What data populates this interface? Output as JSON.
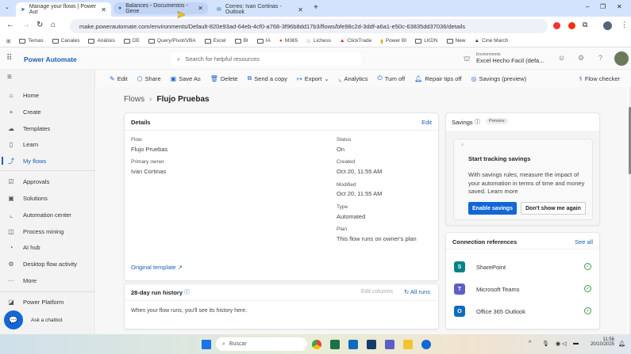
{
  "browser": {
    "tabs": [
      {
        "label": "Manage your flows | Power Aut",
        "active": true
      },
      {
        "label": "Balances - Documentos - Gene",
        "active": false
      },
      {
        "label": "Correo: Ivan Cortinas - Outlook",
        "active": false
      }
    ],
    "new_tab": "+",
    "url": "make.powerautomate.com/environments/Default-820e93ad-64eb-4cf0-a768-3f96b8dd17b3/flows/bfe98c2d-3ddf-a6a1-e50c-63835dd37036/details",
    "bookmarks": [
      "Temas",
      "Canales",
      "Análisis",
      "DE",
      "Query/Pivot/VBA",
      "Excel",
      "BI",
      "IA",
      "M365",
      "Lichess",
      "ClickTrade",
      "Power BI",
      "LKDN",
      "New",
      "Cine March"
    ]
  },
  "app": {
    "name": "Power Automate",
    "search_placeholder": "Search for helpful resources",
    "env_label": "Environments",
    "env_name": "Excel Hecho Facil (defa..."
  },
  "commands": [
    "Edit",
    "Share",
    "Save As",
    "Delete",
    "Send a copy",
    "Export",
    "Analytics",
    "Turn off",
    "Repair tips off",
    "Savings (preview)"
  ],
  "flow_checker": "Flow checker",
  "sidebar": {
    "items": [
      {
        "label": "Home",
        "icon": "⌂"
      },
      {
        "label": "Create",
        "icon": "+"
      },
      {
        "label": "Templates",
        "icon": "☁"
      },
      {
        "label": "Learn",
        "icon": "▯"
      },
      {
        "label": "My flows",
        "icon": "⤴"
      },
      {
        "label": "Approvals",
        "icon": "☑"
      },
      {
        "label": "Solutions",
        "icon": "▣"
      },
      {
        "label": "Automation center",
        "icon": "⌞"
      },
      {
        "label": "Process mining",
        "icon": "◫"
      },
      {
        "label": "AI hub",
        "icon": "◔"
      },
      {
        "label": "Desktop flow activity",
        "icon": "⚙"
      },
      {
        "label": "More",
        "icon": "···"
      },
      {
        "label": "Power Platform",
        "icon": "◪"
      }
    ],
    "chatbot": "Ask a chatbot"
  },
  "breadcrumb": {
    "root": "Flows",
    "current": "Flujo Pruebas"
  },
  "details": {
    "title": "Details",
    "edit": "Edit",
    "flow_label": "Flow",
    "flow": "Flujo Pruebas",
    "owner_label": "Primary owner",
    "owner": "Ivan Cortinas",
    "status_label": "Status",
    "status": "On",
    "created_label": "Created",
    "created": "Oct 20, 11:55 AM",
    "modified_label": "Modified",
    "modified": "Oct 20, 11:55 AM",
    "type_label": "Type",
    "type": "Automated",
    "plan_label": "Plan",
    "plan": "This flow runs on owner's plan",
    "template_link": "Original template"
  },
  "run_history": {
    "title": "28-day run history",
    "edit_columns": "Edit columns",
    "all_runs": "All runs",
    "empty": "When your flow runs, you'll see its history here."
  },
  "savings": {
    "title": "Savings",
    "badge": "Preview",
    "heading": "Start tracking savings",
    "body": "With savings rules, measure the impact of your automation in terms of time and money saved.",
    "learn_more": "Learn more",
    "enable": "Enable savings",
    "dismiss": "Don't show me again"
  },
  "connections": {
    "title": "Connection references",
    "see_all": "See all",
    "items": [
      {
        "name": "SharePoint",
        "color": "#038387"
      },
      {
        "name": "Microsoft Teams",
        "color": "#5b5fc7"
      },
      {
        "name": "Office 365 Outlook",
        "color": "#0f6cbd"
      }
    ]
  },
  "taskbar": {
    "search": "Buscar",
    "time": "11:56",
    "date": "20/10/2025"
  }
}
